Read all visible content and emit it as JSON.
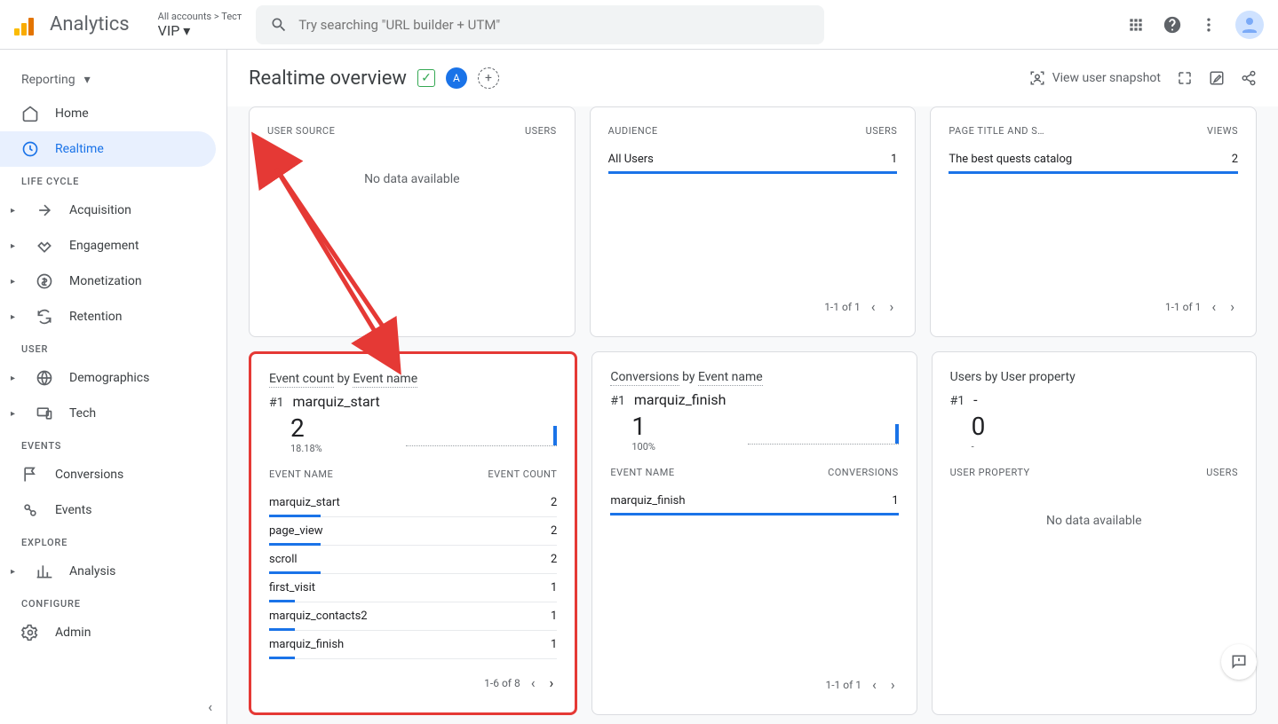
{
  "branding": {
    "product": "Analytics"
  },
  "account_picker": {
    "breadcrumb": "All accounts > Тест",
    "property": "VIP"
  },
  "search": {
    "placeholder": "Try searching \"URL builder + UTM\""
  },
  "sidebar": {
    "reporting": "Reporting",
    "home": "Home",
    "realtime": "Realtime",
    "section_lifecycle": "LIFE CYCLE",
    "acquisition": "Acquisition",
    "engagement": "Engagement",
    "monetization": "Monetization",
    "retention": "Retention",
    "section_user": "USER",
    "demographics": "Demographics",
    "tech": "Tech",
    "section_events": "EVENTS",
    "conversions": "Conversions",
    "events": "Events",
    "section_explore": "EXPLORE",
    "analysis": "Analysis",
    "section_configure": "CONFIGURE",
    "admin": "Admin"
  },
  "page": {
    "title": "Realtime overview",
    "comparison_pill": "A",
    "snapshot_label": "View user snapshot"
  },
  "cards": {
    "user_source": {
      "col1": "USER SOURCE",
      "col2": "USERS",
      "no_data": "No data available"
    },
    "audience": {
      "col1": "AUDIENCE",
      "col2": "USERS",
      "rows": [
        {
          "label": "All Users",
          "value": "1",
          "bar_pct": 100
        }
      ],
      "pager": "1-1 of 1"
    },
    "page_title": {
      "col1": "PAGE TITLE AND S…",
      "col2": "VIEWS",
      "rows": [
        {
          "label": "The best quests catalog",
          "value": "2",
          "bar_pct": 100
        }
      ],
      "pager": "1-1 of 1"
    },
    "event_count": {
      "title_pref": "Event count",
      "title_by": " by ",
      "title_dim": "Event name",
      "rank": "#1",
      "top_event": "marquiz_start",
      "top_value": "2",
      "top_pct": "18.18%",
      "col1": "EVENT NAME",
      "col2": "EVENT COUNT",
      "rows": [
        {
          "label": "marquiz_start",
          "value": "2",
          "bar_pct": 18
        },
        {
          "label": "page_view",
          "value": "2",
          "bar_pct": 18
        },
        {
          "label": "scroll",
          "value": "2",
          "bar_pct": 18
        },
        {
          "label": "first_visit",
          "value": "1",
          "bar_pct": 9
        },
        {
          "label": "marquiz_contacts2",
          "value": "1",
          "bar_pct": 9
        },
        {
          "label": "marquiz_finish",
          "value": "1",
          "bar_pct": 9
        }
      ],
      "pager": "1-6 of 8"
    },
    "conversions": {
      "title_pref": "Conversions",
      "title_by": " by ",
      "title_dim": "Event name",
      "rank": "#1",
      "top_event": "marquiz_finish",
      "top_value": "1",
      "top_pct": "100%",
      "col1": "EVENT NAME",
      "col2": "CONVERSIONS",
      "rows": [
        {
          "label": "marquiz_finish",
          "value": "1",
          "bar_pct": 100
        }
      ],
      "pager": "1-1 of 1"
    },
    "user_property": {
      "title_pref": "Users",
      "title_by": " by ",
      "title_dim": "User property",
      "rank": "#1",
      "top_event": "-",
      "top_value": "0",
      "top_pct": "-",
      "col1": "USER PROPERTY",
      "col2": "USERS",
      "no_data": "No data available"
    }
  }
}
